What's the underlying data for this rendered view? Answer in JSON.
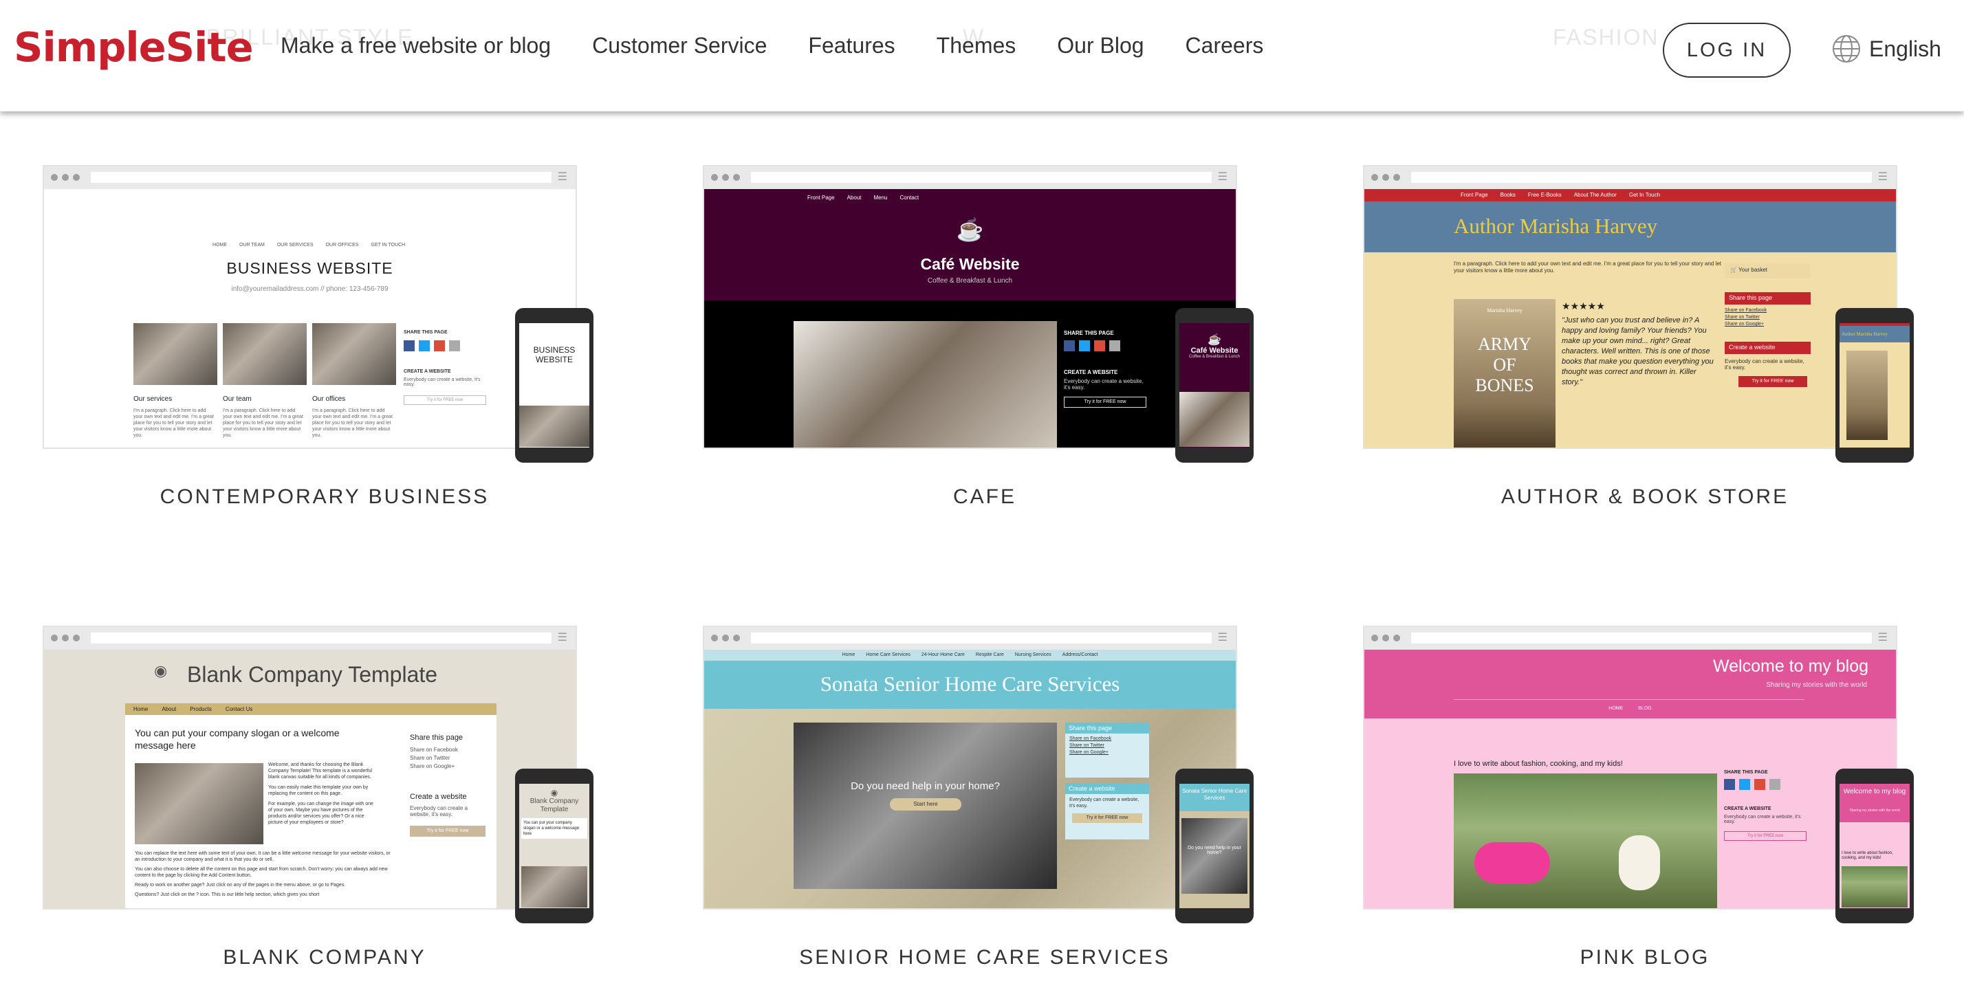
{
  "header": {
    "logo": "SimpleSite",
    "nav": [
      "Make a free website or blog",
      "Customer Service",
      "Features",
      "Themes",
      "Our Blog",
      "Careers"
    ],
    "login": "LOG IN",
    "language": "English",
    "ghost": [
      "BRILLIANT STYLE",
      "W",
      "FASHION"
    ]
  },
  "templates": [
    {
      "caption": "CONTEMPORARY BUSINESS",
      "site": {
        "nav": [
          "HOME",
          "OUR TEAM",
          "OUR SERVICES",
          "OUR OFFICES",
          "GET IN TOUCH"
        ],
        "title": "BUSINESS WEBSITE",
        "subtitle": "info@youremailaddress.com // phone: 123-456-789",
        "cols": [
          "Our services",
          "Our team",
          "Our offices"
        ],
        "col_text": "I'm a paragraph. Click here to add your own text and edit me. I'm a great place for you to tell your story and let your visitors know a little more about you.",
        "share": "SHARE THIS PAGE",
        "create": "CREATE A WEBSITE",
        "create_text": "Everybody can create a website, it's easy.",
        "cta": "Try it for FREE now",
        "phone_title": "BUSINESS WEBSITE"
      }
    },
    {
      "caption": "CAFE",
      "site": {
        "nav": [
          "Front Page",
          "About",
          "Menu",
          "Contact"
        ],
        "title": "Café Website",
        "subtitle": "Coffee & Breakfast & Lunch",
        "share": "SHARE THIS PAGE",
        "create": "CREATE A WEBSITE",
        "create_text": "Everybody can create a website, it's easy.",
        "cta": "Try it for FREE now",
        "phone_title": "Café Website",
        "phone_sub": "Coffee & Breakfast & Lunch"
      }
    },
    {
      "caption": "AUTHOR & BOOK STORE",
      "site": {
        "nav": [
          "Front Page",
          "Books",
          "Free E-Books",
          "About The Author",
          "Get In Touch"
        ],
        "title": "Author Marisha Harvey",
        "intro": "I'm a paragraph. Click here to add your own text and edit me. I'm a great place for you to tell your story and let your visitors know a little more about you.",
        "basket": "Your basket",
        "book_author": "Marisha Harvey",
        "book_title": "ARMY OF BONES",
        "stars": "★★★★★",
        "quote": "\"Just who can you trust and believe in? A happy and loving family? Your friends? You make up your own mind... right? Great characters. Well written. This is one of those books that make you question everything you thought was correct and thrown in. Killer story.\"",
        "share": "Share this page",
        "share_links": [
          "Share on Facebook",
          "Share on Twitter",
          "Share on Google+"
        ],
        "create": "Create a website",
        "create_text": "Everybody can create a website, it's easy.",
        "cta": "Try it for FREE now",
        "phone_title": "Author Marisha Harvey"
      }
    },
    {
      "caption": "BLANK COMPANY",
      "site": {
        "title": "Blank Company Template",
        "nav": [
          "Home",
          "About",
          "Products",
          "Contact Us"
        ],
        "slogan": "You can put your company slogan or a welcome message here",
        "welcome": "Welcome, and thanks for choosing the Blank Company Template! This template is a wonderful blank canvas suitable for all kinds of companies.",
        "p2": "You can easily make this template your own by replacing the content on this page.",
        "p3": "For example, you can change the image with one of your own. Maybe you have pictures of the products and/or services you offer? Or a nice picture of your employees or store?",
        "p4": "You can replace the text here with some text of your own. It can be a little welcome message for your website visitors, or an introduction to your company and what it is that you do or sell.",
        "p5": "You can also choose to delete all the content on this page and start from scratch. Don't worry: you can always add new content to the page by clicking the Add Content button.",
        "p6": "Ready to work on another page? Just click on any of the pages in the menu above, or go to Pages.",
        "p7": "Questions? Just click on the ? icon. This is our little help section, which gives you short",
        "share": "Share this page",
        "share_links": [
          "Share on Facebook",
          "Share on Twitter",
          "Share on Google+"
        ],
        "create": "Create a website",
        "create_text": "Everybody can create a website, it's easy.",
        "cta": "Try it for FREE now",
        "phone_title": "Blank Company Template",
        "phone_slogan": "You can put your company slogan or a welcome message here"
      }
    },
    {
      "caption": "SENIOR HOME CARE SERVICES",
      "site": {
        "nav": [
          "Home",
          "Home Care Services",
          "24-Hour Home Care",
          "Respite Care",
          "Nursing Services",
          "Address/Contact"
        ],
        "title": "Sonata Senior Home Care Services",
        "hero": "Do you need help in your home?",
        "start": "Start here",
        "share": "Share this page",
        "share_links": [
          "Share on Facebook",
          "Share on Twitter",
          "Share on Google+"
        ],
        "create": "Create a website",
        "create_text": "Everybody can create a website, it's easy.",
        "cta": "Try it for FREE now",
        "phone_title": "Sonata Senior Home Care Services",
        "phone_hero": "Do you need help in your home?"
      }
    },
    {
      "caption": "PINK BLOG",
      "site": {
        "title": "Welcome to my blog",
        "subtitle": "Sharing my stories with the world",
        "nav": [
          "HOME",
          "BLOG"
        ],
        "post": "I love to write about fashion, cooking, and my kids!",
        "share": "SHARE THIS PAGE",
        "create": "CREATE A WEBSITE",
        "create_text": "Everybody can create a website, it's easy.",
        "cta": "Try it for FREE now",
        "phone_title": "Welcome to my blog",
        "phone_sub": "Sharing my stories with the world",
        "phone_post": "I love to write about fashion, cooking, and my kids!"
      }
    }
  ],
  "colors": {
    "brand_red": "#c9202e",
    "cafe_purple": "#42002e",
    "author_red": "#c1272d",
    "author_blue": "#5a7fa0",
    "senior_teal": "#6ec3d2",
    "pink_magenta": "#e0559a",
    "pink_light": "#fbc7e1"
  }
}
